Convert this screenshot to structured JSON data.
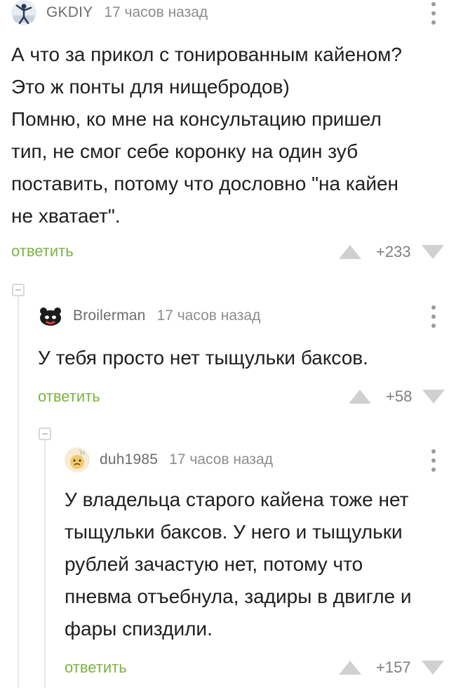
{
  "comments": [
    {
      "author": "GKDIY",
      "time": "17 часов назад",
      "lines": [
        "А что за прикол с тонированным кайеном?",
        "Это ж понты для нищебродов)",
        "Помню, ко мне на консультацию пришел",
        "тип, не смог себе коронку на один зуб",
        "поставить, потому что дословно \"на кайен",
        "не хватает\"."
      ],
      "reply_label": "ответить",
      "score": "+233"
    },
    {
      "author": "Broilerman",
      "time": "17 часов назад",
      "lines": [
        "У тебя просто нет тыщульки баксов."
      ],
      "reply_label": "ответить",
      "score": "+58"
    },
    {
      "author": "duh1985",
      "time": "17 часов назад",
      "lines": [
        "У владельца старого кайена тоже нет",
        "тыщульки баксов. У него и тыщульки",
        "рублей зачастую нет, потому что",
        "пневма отъебнула, задиры в двигле и",
        "фары спиздили."
      ],
      "reply_label": "ответить",
      "score": "+157"
    }
  ],
  "colors": {
    "reply": "#7cb342",
    "meta": "#8d8d8d",
    "text": "#202020",
    "vote_arrow": "#d0d0d0"
  }
}
